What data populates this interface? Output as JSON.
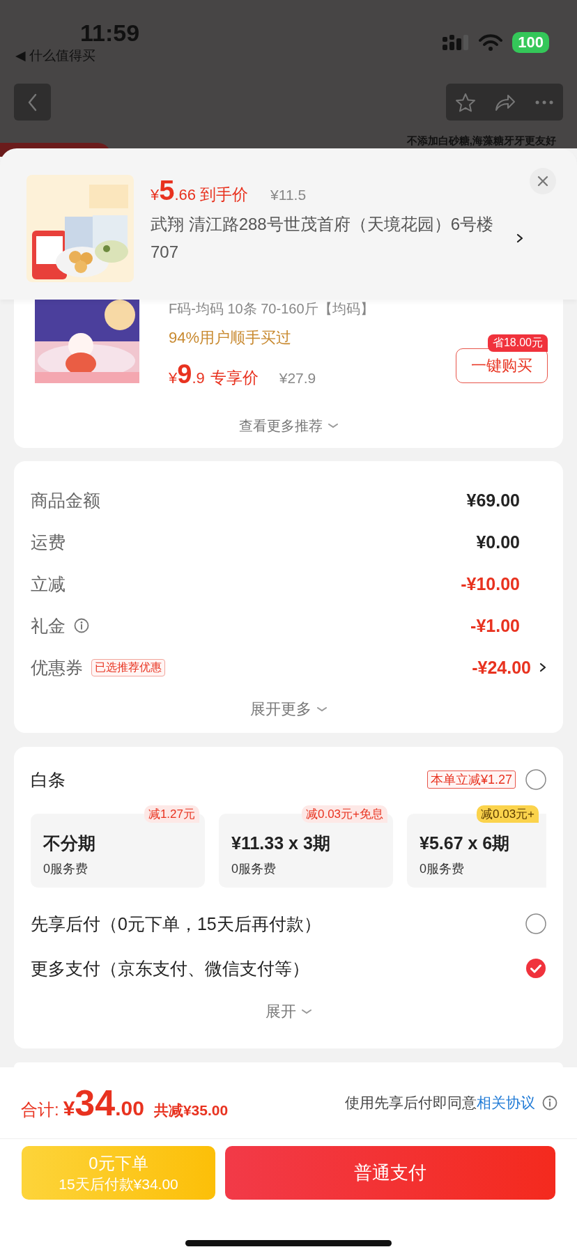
{
  "status_bar": {
    "time": "11:59",
    "back_app": "◀ 什么值得买",
    "battery": "100"
  },
  "nav": {
    "banner_text": "不添加白砂糖,海藻糖牙牙更友好"
  },
  "popup": {
    "price_symbol": "¥",
    "price_int": "5",
    "price_dec": ".66",
    "price_label": "到手价",
    "original_price": "¥11.5",
    "address": "武翔  清江路288号世茂首府（天境花园）6号楼707"
  },
  "recommendation": {
    "spec": "F码-均码 10条 70-160斤【均码】",
    "bought": "94%用户顺手买过",
    "price_symbol": "¥",
    "price_int": "9",
    "price_dec": ".9",
    "price_label": "专享价",
    "original_price": "¥27.9",
    "save_badge": "省18.00元",
    "buy_button": "一键购买",
    "more": "查看更多推荐"
  },
  "costs": {
    "rows": [
      {
        "label": "商品金额",
        "value": "¥69.00",
        "kind": "plain"
      },
      {
        "label": "运费",
        "value": "¥0.00",
        "kind": "plain"
      },
      {
        "label": "立减",
        "value": "-¥10.00",
        "kind": "deduction"
      },
      {
        "label": "礼金",
        "value": "-¥1.00",
        "kind": "gift"
      },
      {
        "label": "优惠券",
        "tag": "已选推荐优惠",
        "value": "-¥24.00",
        "kind": "coupon"
      }
    ],
    "expand": "展开更多"
  },
  "payment": {
    "title": "白条",
    "promo": "本单立减¥1.27",
    "selected": false,
    "plans": [
      {
        "badge": "减1.27元",
        "title": "不分期",
        "fee": "0服务费",
        "highlight": false
      },
      {
        "badge": "减0.03元+免息",
        "title": "¥11.33 x 3期",
        "fee": "0服务费",
        "highlight": false
      },
      {
        "badge": "减0.03元+",
        "title": "¥5.67 x 6期",
        "fee": "0服务费",
        "highlight": true
      }
    ],
    "options": [
      {
        "label": "先享后付（0元下单，15天后再付款）",
        "selected": false
      },
      {
        "label": "更多支付（京东支付、微信支付等）",
        "selected": true
      }
    ],
    "expand": "展开"
  },
  "footer": {
    "total_label": "合计:",
    "total_symbol": "¥",
    "total_int": "34",
    "total_dec": ".00",
    "saved": "共减¥35.00",
    "agreement": "使用先享后付即同意",
    "agreement_link": "相关协议",
    "later_title": "0元下单",
    "later_subtitle": "15天后付款¥34.00",
    "pay_button": "普通支付"
  }
}
